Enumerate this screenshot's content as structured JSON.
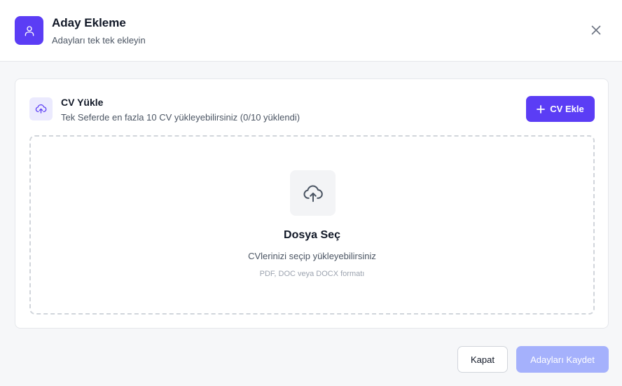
{
  "header": {
    "title": "Aday Ekleme",
    "subtitle": "Adayları tek tek ekleyin",
    "icon": "user-icon",
    "close_icon": "close-icon"
  },
  "upload": {
    "title": "CV Yükle",
    "subtitle": "Tek Seferde en fazla 10 CV yükleyebilirsiniz (0/10 yüklendi)",
    "icon": "cloud-upload-icon",
    "add_button_label": "CV Ekle",
    "add_button_icon": "plus-icon"
  },
  "dropzone": {
    "icon": "cloud-upload-icon",
    "title": "Dosya Seç",
    "subtitle": "CVlerinizi seçip yükleyebilirsiniz",
    "hint": "PDF, DOC veya DOCX formatı"
  },
  "footer": {
    "close_label": "Kapat",
    "save_label": "Adayları Kaydet"
  },
  "colors": {
    "accent": "#5b3df5",
    "accent_disabled": "#a5b1fc",
    "icon_tint_bg": "#ebeafe"
  }
}
